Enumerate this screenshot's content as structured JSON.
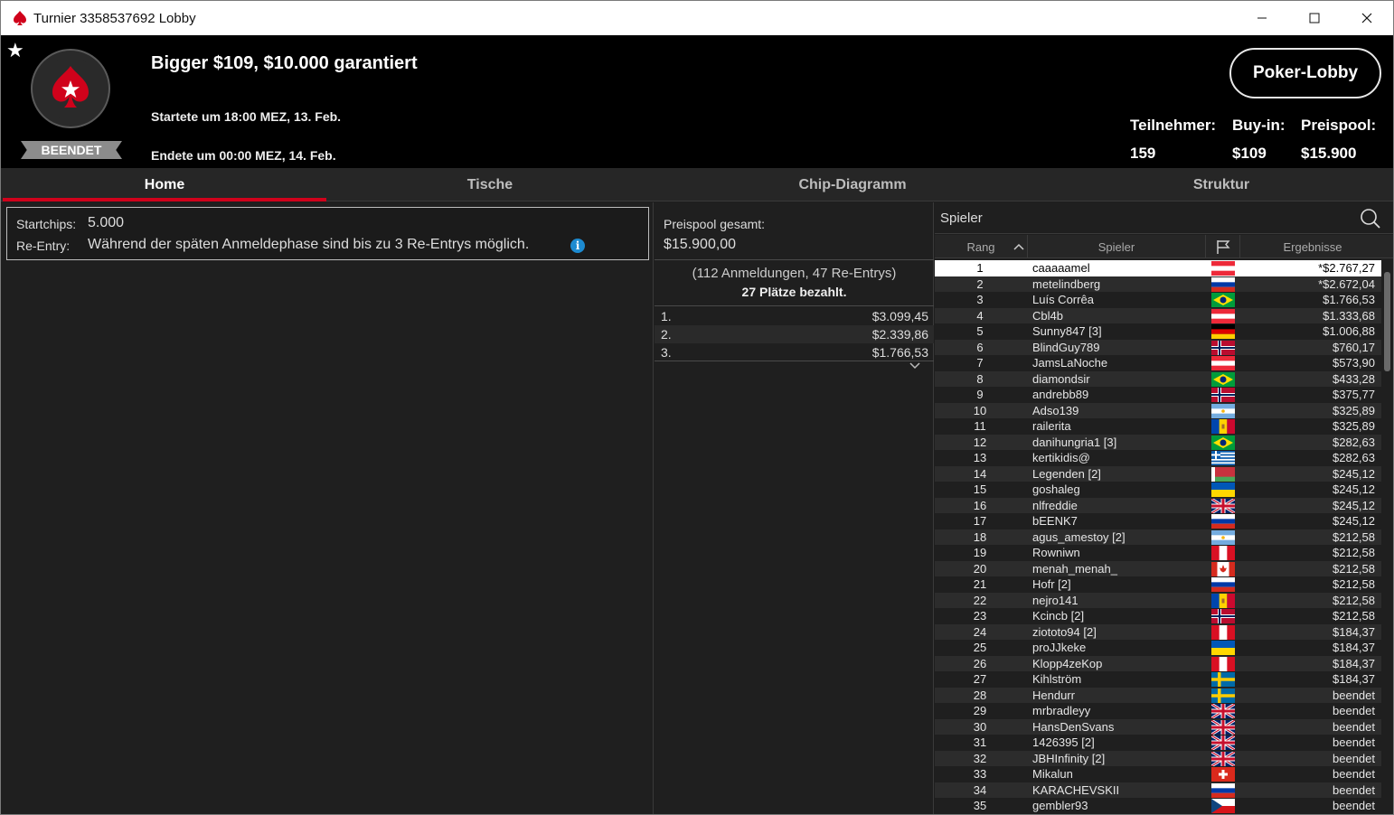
{
  "window": {
    "title": "Turnier 3358537692 Lobby",
    "icons": [
      "pokerstars-spade-icon",
      "minimize-icon",
      "maximize-icon",
      "close-icon"
    ]
  },
  "header": {
    "tournament_name": "Bigger $109, $10.000 garantiert",
    "started": "Startete um 18:00 MEZ, 13. Feb.",
    "ended": "Endete um 00:00 MEZ, 14. Feb.",
    "status": "BEENDET",
    "lobby_button": "Poker-Lobby",
    "stats": {
      "participants_label": "Teilnehmer:",
      "participants_value": "159",
      "buyin_label": "Buy-in:",
      "buyin_value": "$109",
      "prizepool_label": "Preispool:",
      "prizepool_value": "$15.900"
    }
  },
  "tabs": [
    {
      "label": "Home",
      "active": true
    },
    {
      "label": "Tische",
      "active": false
    },
    {
      "label": "Chip-Diagramm",
      "active": false
    },
    {
      "label": "Struktur",
      "active": false
    }
  ],
  "info": {
    "startchips_label": "Startchips:",
    "startchips_value": "5.000",
    "reentry_label": "Re-Entry:",
    "reentry_value": "Während der späten Anmeldephase sind bis zu 3 Re-Entrys möglich."
  },
  "prizepool": {
    "label": "Preispool gesamt:",
    "value": "$15.900,00",
    "entries": "(112 Anmeldungen, 47 Re-Entrys)",
    "paid": "27 Plätze bezahlt.",
    "payouts": [
      {
        "place": "1.",
        "amount": "$3.099,45"
      },
      {
        "place": "2.",
        "amount": "$2.339,86"
      },
      {
        "place": "3.",
        "amount": "$1.766,53"
      }
    ]
  },
  "players": {
    "search_placeholder": "Spieler",
    "columns": {
      "rank": "Rang",
      "player": "Spieler",
      "flag": "flag-icon",
      "result": "Ergebnisse"
    },
    "rows": [
      {
        "rank": "1",
        "name": "caaaaamel",
        "flag": "at",
        "result": "*$2.767,27"
      },
      {
        "rank": "2",
        "name": "metelindberg",
        "flag": "ru",
        "result": "*$2.672,04"
      },
      {
        "rank": "3",
        "name": "Luís Corrêa",
        "flag": "br",
        "result": "$1.766,53"
      },
      {
        "rank": "4",
        "name": "Cbl4b",
        "flag": "at",
        "result": "$1.333,68"
      },
      {
        "rank": "5",
        "name": "Sunny847 [3]",
        "flag": "de",
        "result": "$1.006,88"
      },
      {
        "rank": "6",
        "name": "BlindGuy789",
        "flag": "no",
        "result": "$760,17"
      },
      {
        "rank": "7",
        "name": "JamsLaNoche",
        "flag": "at",
        "result": "$573,90"
      },
      {
        "rank": "8",
        "name": "diamondsir",
        "flag": "br",
        "result": "$433,28"
      },
      {
        "rank": "9",
        "name": "andrebb89",
        "flag": "no",
        "result": "$375,77"
      },
      {
        "rank": "10",
        "name": "Adso139",
        "flag": "ar",
        "result": "$325,89"
      },
      {
        "rank": "11",
        "name": "railerita",
        "flag": "md",
        "result": "$325,89"
      },
      {
        "rank": "12",
        "name": "danihungria1 [3]",
        "flag": "br",
        "result": "$282,63"
      },
      {
        "rank": "13",
        "name": "kertikidis@",
        "flag": "gr",
        "result": "$282,63"
      },
      {
        "rank": "14",
        "name": "Legenden [2]",
        "flag": "by",
        "result": "$245,12"
      },
      {
        "rank": "15",
        "name": "goshaleg",
        "flag": "ua",
        "result": "$245,12"
      },
      {
        "rank": "16",
        "name": "nlfreddie",
        "flag": "gb",
        "result": "$245,12"
      },
      {
        "rank": "17",
        "name": "bEENK7",
        "flag": "ru",
        "result": "$245,12"
      },
      {
        "rank": "18",
        "name": "agus_amestoy [2]",
        "flag": "ar",
        "result": "$212,58"
      },
      {
        "rank": "19",
        "name": "Rowniwn",
        "flag": "pe",
        "result": "$212,58"
      },
      {
        "rank": "20",
        "name": "menah_menah_",
        "flag": "ca",
        "result": "$212,58"
      },
      {
        "rank": "21",
        "name": "Hofr [2]",
        "flag": "ru",
        "result": "$212,58"
      },
      {
        "rank": "22",
        "name": "nejro141",
        "flag": "md",
        "result": "$212,58"
      },
      {
        "rank": "23",
        "name": "Kcincb [2]",
        "flag": "no",
        "result": "$212,58"
      },
      {
        "rank": "24",
        "name": "ziototo94 [2]",
        "flag": "pe",
        "result": "$184,37"
      },
      {
        "rank": "25",
        "name": "proJJkeke",
        "flag": "ua",
        "result": "$184,37"
      },
      {
        "rank": "26",
        "name": "Klopp4zeKop",
        "flag": "pe",
        "result": "$184,37"
      },
      {
        "rank": "27",
        "name": "Kihlström",
        "flag": "se",
        "result": "$184,37"
      },
      {
        "rank": "28",
        "name": "Hendurr",
        "flag": "se",
        "result": "beendet"
      },
      {
        "rank": "29",
        "name": "mrbradleyy",
        "flag": "gb",
        "result": "beendet"
      },
      {
        "rank": "30",
        "name": "HansDenSvans",
        "flag": "gb",
        "result": "beendet"
      },
      {
        "rank": "31",
        "name": "1426395 [2]",
        "flag": "gb",
        "result": "beendet"
      },
      {
        "rank": "32",
        "name": "JBHInfinity [2]",
        "flag": "gb",
        "result": "beendet"
      },
      {
        "rank": "33",
        "name": "Mikalun",
        "flag": "ch",
        "result": "beendet"
      },
      {
        "rank": "34",
        "name": "KARACHEVSKII",
        "flag": "ru",
        "result": "beendet"
      },
      {
        "rank": "35",
        "name": "gembler93",
        "flag": "cz",
        "result": "beendet"
      }
    ]
  },
  "colors": {
    "accent_red": "#d0021b",
    "header_bg": "#000000",
    "panel_bg": "#1f1f1f",
    "info_icon": "#1d8bd1"
  }
}
